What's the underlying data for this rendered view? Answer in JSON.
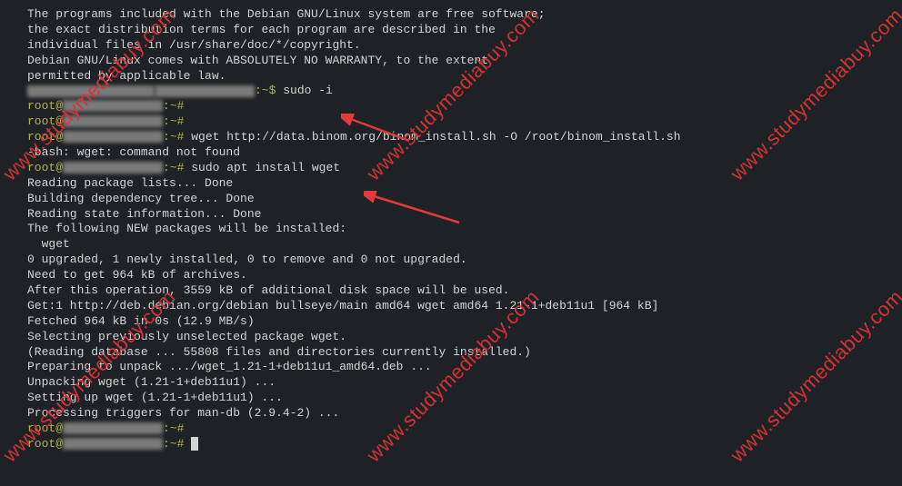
{
  "terminal": {
    "lines": [
      "",
      "The programs included with the Debian GNU/Linux system are free software;",
      "the exact distribution terms for each program are described in the",
      "individual files in /usr/share/doc/*/copyright.",
      "",
      "Debian GNU/Linux comes with ABSOLUTELY NO WARRANTY, to the extent",
      "permitted by applicable law."
    ],
    "prompt_user_host": ":~$ ",
    "cmd_sudo_i": "sudo -i",
    "root_prompt_suffix": ":~# ",
    "cmd_wget_binom": "wget http://data.binom.org/binom_install.sh -O /root/binom_install.sh",
    "wget_error": "-bash: wget: command not found",
    "cmd_install_wget": "sudo apt install wget",
    "apt_output": [
      "Reading package lists... Done",
      "Building dependency tree... Done",
      "Reading state information... Done",
      "The following NEW packages will be installed:",
      "  wget",
      "0 upgraded, 1 newly installed, 0 to remove and 0 not upgraded.",
      "Need to get 964 kB of archives.",
      "After this operation, 3559 kB of additional disk space will be used.",
      "Get:1 http://deb.debian.org/debian bullseye/main amd64 wget amd64 1.21-1+deb11u1 [964 kB]",
      "Fetched 964 kB in 0s (12.9 MB/s)",
      "Selecting previously unselected package wget.",
      "(Reading database ... 55808 files and directories currently installed.)",
      "Preparing to unpack .../wget_1.21-1+deb11u1_amd64.deb ...",
      "Unpacking wget (1.21-1+deb11u1) ...",
      "Setting up wget (1.21-1+deb11u1) ...",
      "Processing triggers for man-db (2.9.4-2) ..."
    ],
    "root_at": "root@"
  },
  "watermark_text": "www.studymediabuy.com"
}
